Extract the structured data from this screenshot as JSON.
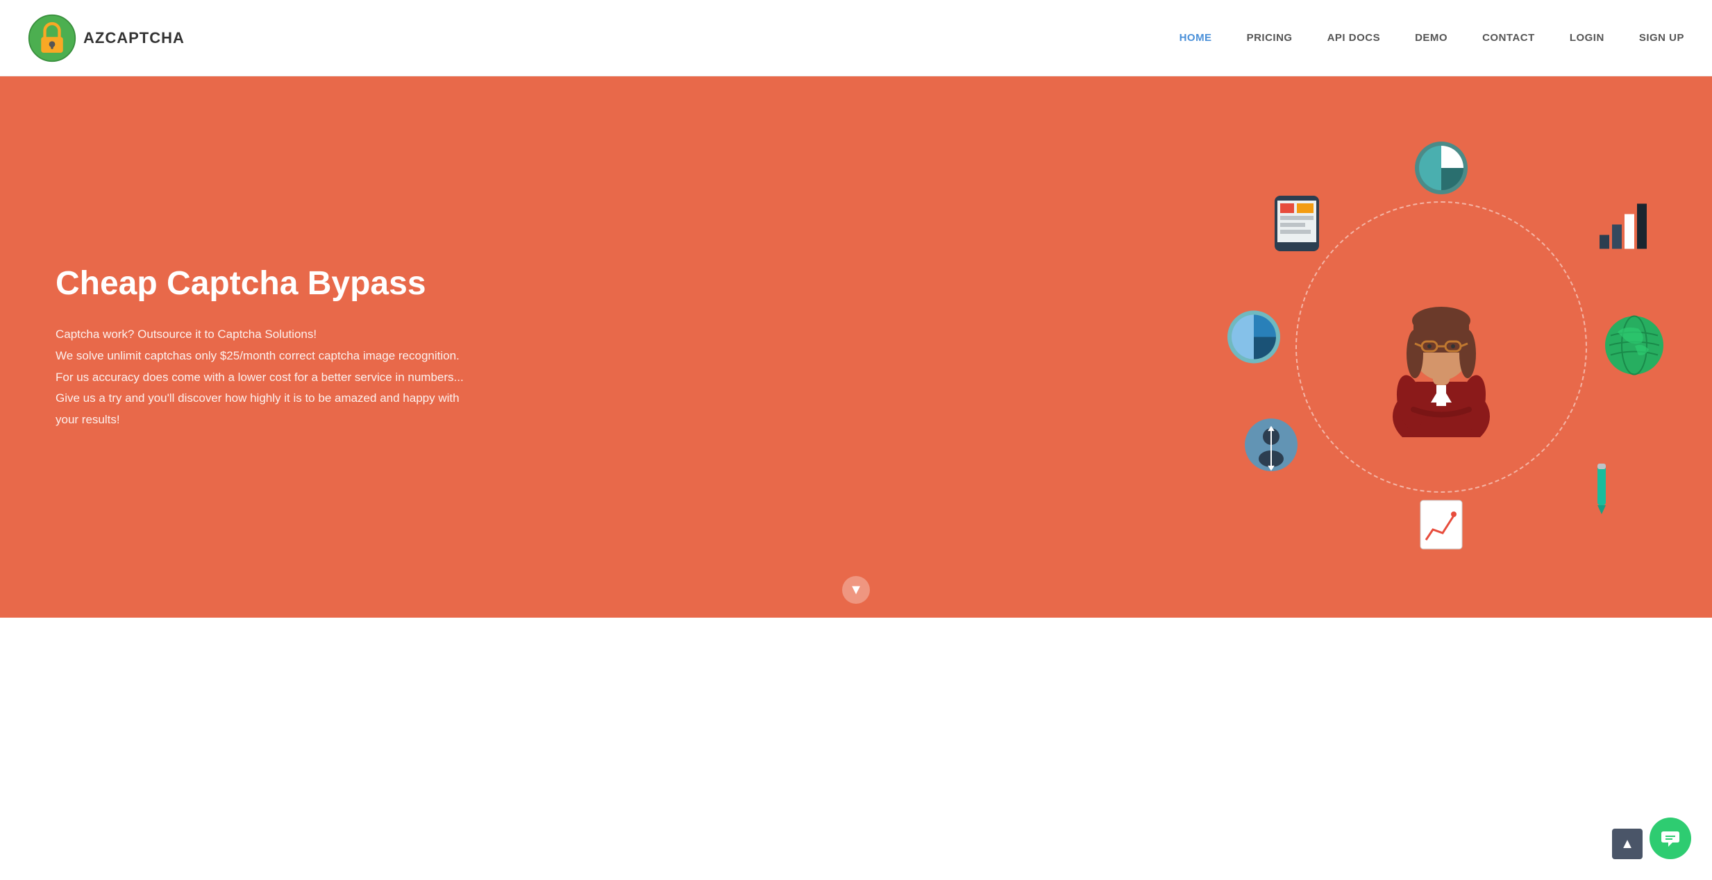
{
  "logo": {
    "text": "AZCAPTCHA",
    "alt": "AZCaptcha Logo"
  },
  "nav": {
    "items": [
      {
        "label": "HOME",
        "active": true
      },
      {
        "label": "PRICING",
        "active": false
      },
      {
        "label": "API DOCS",
        "active": false
      },
      {
        "label": "DEMO",
        "active": false
      },
      {
        "label": "CONTACT",
        "active": false
      },
      {
        "label": "LOGIN",
        "active": false
      },
      {
        "label": "SIGN UP",
        "active": false
      }
    ]
  },
  "hero": {
    "title": "Cheap Captcha Bypass",
    "desc_line1": "Captcha work? Outsource it to Captcha Solutions!",
    "desc_line2": "We solve unlimit captchas only $25/month correct captcha image recognition.",
    "desc_line3": "For us accuracy does come with a lower cost for a better service in numbers...",
    "desc_line4": "Give us a try and you'll discover how highly it is to be amazed and happy with your results!",
    "bg_color": "#e8694a"
  },
  "colors": {
    "nav_active": "#4a90d9",
    "hero_bg": "#e8694a",
    "chat_green": "#2ecc71"
  }
}
